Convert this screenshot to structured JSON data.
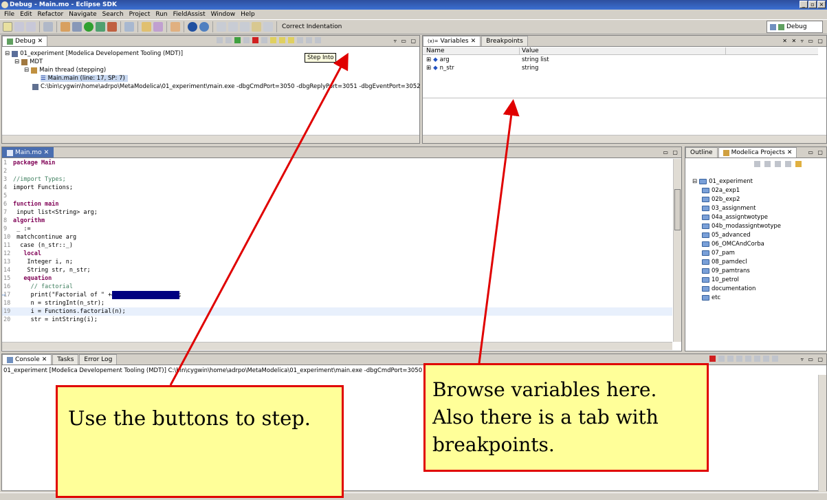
{
  "window": {
    "title": "Debug - Main.mo - Eclipse SDK"
  },
  "menu": [
    "File",
    "Edit",
    "Refactor",
    "Navigate",
    "Search",
    "Project",
    "Run",
    "FieldAssist",
    "Window",
    "Help"
  ],
  "toolbar": {
    "correct_indentation": "Correct Indentation",
    "perspective": "Debug"
  },
  "debug_view": {
    "tab": "Debug",
    "tooltip": "Step Into",
    "tree": [
      "01_experiment [Modelica Developement Tooling (MDT)]",
      "MDT",
      "Main thread (stepping)",
      "Main.main (line: 17, SP: 7)",
      "C:\\bin\\cygwin\\home\\adrpo\\MetaModelica\\01_experiment\\main.exe -dbgCmdPort=3050 -dbgReplyPort=3051 -dbgEventPort=3052 -di"
    ]
  },
  "variables_view": {
    "tabs": [
      "Variables",
      "Breakpoints"
    ],
    "columns": [
      "Name",
      "Value"
    ],
    "rows": [
      {
        "name": "arg",
        "value": "string list"
      },
      {
        "name": "n_str",
        "value": "string"
      }
    ]
  },
  "editor": {
    "tab": "Main.mo",
    "lines": [
      {
        "n": "1",
        "code": "package Main"
      },
      {
        "n": "2",
        "code": ""
      },
      {
        "n": "3",
        "code": "//import Types;"
      },
      {
        "n": "4",
        "code": "import Functions;"
      },
      {
        "n": "5",
        "code": ""
      },
      {
        "n": "6",
        "code": "function main"
      },
      {
        "n": "7",
        "code": " input list<String> arg;"
      },
      {
        "n": "8",
        "code": "algorithm"
      },
      {
        "n": "9",
        "code": " _ :="
      },
      {
        "n": "10",
        "code": " matchcontinue arg"
      },
      {
        "n": "11",
        "code": "  case (n_str::_)"
      },
      {
        "n": "12",
        "code": "   local"
      },
      {
        "n": "13",
        "code": "    Integer i, n;"
      },
      {
        "n": "14",
        "code": "    String str, n_str;"
      },
      {
        "n": "15",
        "code": "   equation"
      },
      {
        "n": "16",
        "code": "     // factorial"
      },
      {
        "n": "17",
        "code": "     print(\"Factorial of \" +& n_str +& \" is: \");"
      },
      {
        "n": "18",
        "code": "     n = stringInt(n_str);"
      },
      {
        "n": "19",
        "code": "     i = Functions.factorial(n);"
      },
      {
        "n": "20",
        "code": "     str = intString(i);"
      }
    ]
  },
  "outline": {
    "tabs": [
      "Outline",
      "Modelica Projects"
    ],
    "root": "01_experiment",
    "folders": [
      "02a_exp1",
      "02b_exp2",
      "03_assignment",
      "04a_assigntwotype",
      "04b_modassigntwotype",
      "05_advanced",
      "06_OMCAndCorba",
      "07_pam",
      "08_pamdecl",
      "09_pamtrans",
      "10_petrol",
      "documentation",
      "etc"
    ]
  },
  "console": {
    "tabs": [
      "Console",
      "Tasks",
      "Error Log"
    ],
    "line": "01_experiment [Modelica Developement Tooling (MDT)]  C:\\bin\\cygwin\\home\\adrpo\\MetaModelica\\01_experiment\\main.exe -dbgCmdPort=3050 -dbgR"
  },
  "annotations": {
    "step": "Use the buttons to step.",
    "browse_1": "Browse variables here.",
    "browse_2": "Also there is a tab with",
    "browse_3": "breakpoints."
  },
  "colors": {
    "arrow": "#e00000",
    "note_bg": "#ffff99",
    "selection": "#000080"
  }
}
